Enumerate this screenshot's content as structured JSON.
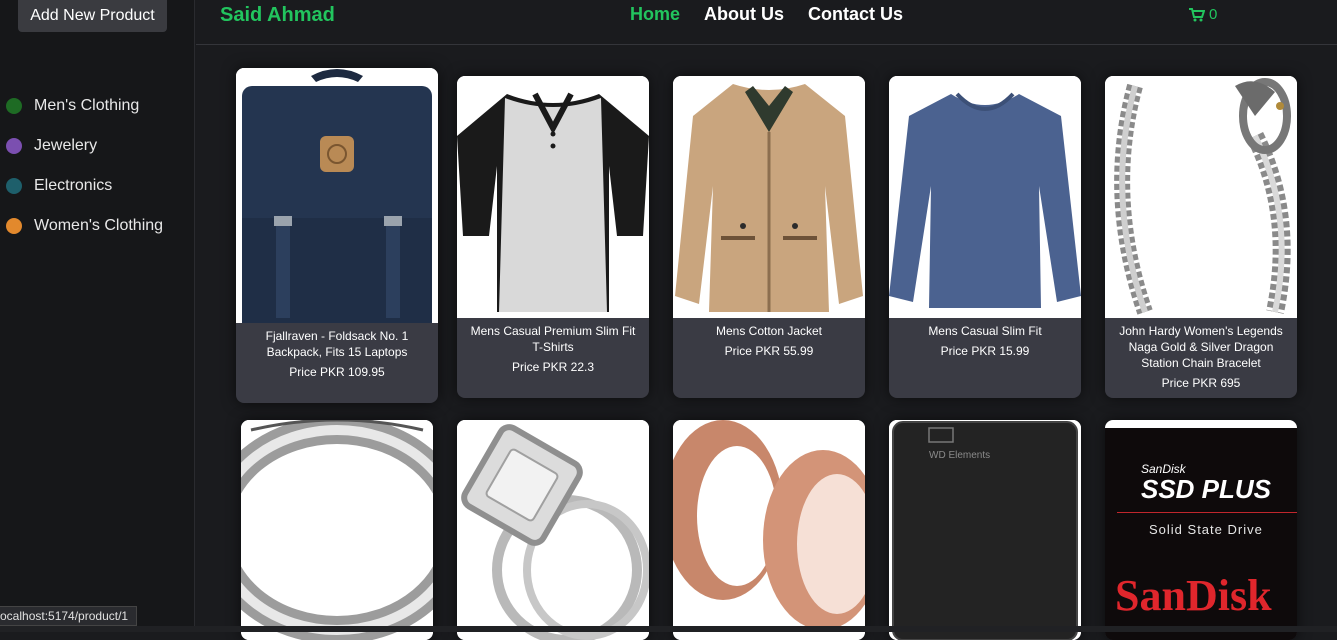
{
  "sidebar": {
    "add_button": "Add New Product",
    "categories": [
      {
        "label": "Men's Clothing",
        "color": "#1e6b24"
      },
      {
        "label": "Jewelery",
        "color": "#7b4fb0"
      },
      {
        "label": "Electronics",
        "color": "#1e5f6b"
      },
      {
        "label": "Women's Clothing",
        "color": "#e2892d"
      }
    ]
  },
  "header": {
    "brand": "Said Ahmad",
    "nav": [
      "Home",
      "About Us",
      "Contact Us"
    ],
    "cart_count": "0"
  },
  "products": [
    {
      "title": "Fjallraven - Foldsack No. 1 Backpack, Fits 15 Laptops",
      "price": "Price PKR 109.95",
      "image": "backpack"
    },
    {
      "title": "Mens Casual Premium Slim Fit T-Shirts",
      "price": "Price PKR 22.3",
      "image": "tshirt"
    },
    {
      "title": "Mens Cotton Jacket",
      "price": "Price PKR 55.99",
      "image": "jacket"
    },
    {
      "title": "Mens Casual Slim Fit",
      "price": "Price PKR 15.99",
      "image": "longsleeve"
    },
    {
      "title": "John Hardy Women's Legends Naga Gold & Silver Dragon Station Chain Bracelet",
      "price": "Price PKR 695",
      "image": "bracelet"
    },
    {
      "title": "",
      "price": "",
      "image": "ring-silver"
    },
    {
      "title": "",
      "price": "",
      "image": "ring-diamond"
    },
    {
      "title": "",
      "price": "",
      "image": "rose-gold-plugs"
    },
    {
      "title": "",
      "price": "",
      "image": "wd-drive"
    },
    {
      "title": "",
      "price": "",
      "image": "sandisk-ssd"
    }
  ],
  "sandisk": {
    "brand_small": "SanDisk",
    "product": "SSD PLUS",
    "sub": "Solid State Drive",
    "logo": "SanDisk"
  },
  "wd": {
    "label": "WD Elements"
  },
  "status": {
    "url": "ocalhost:5174/product/1"
  }
}
